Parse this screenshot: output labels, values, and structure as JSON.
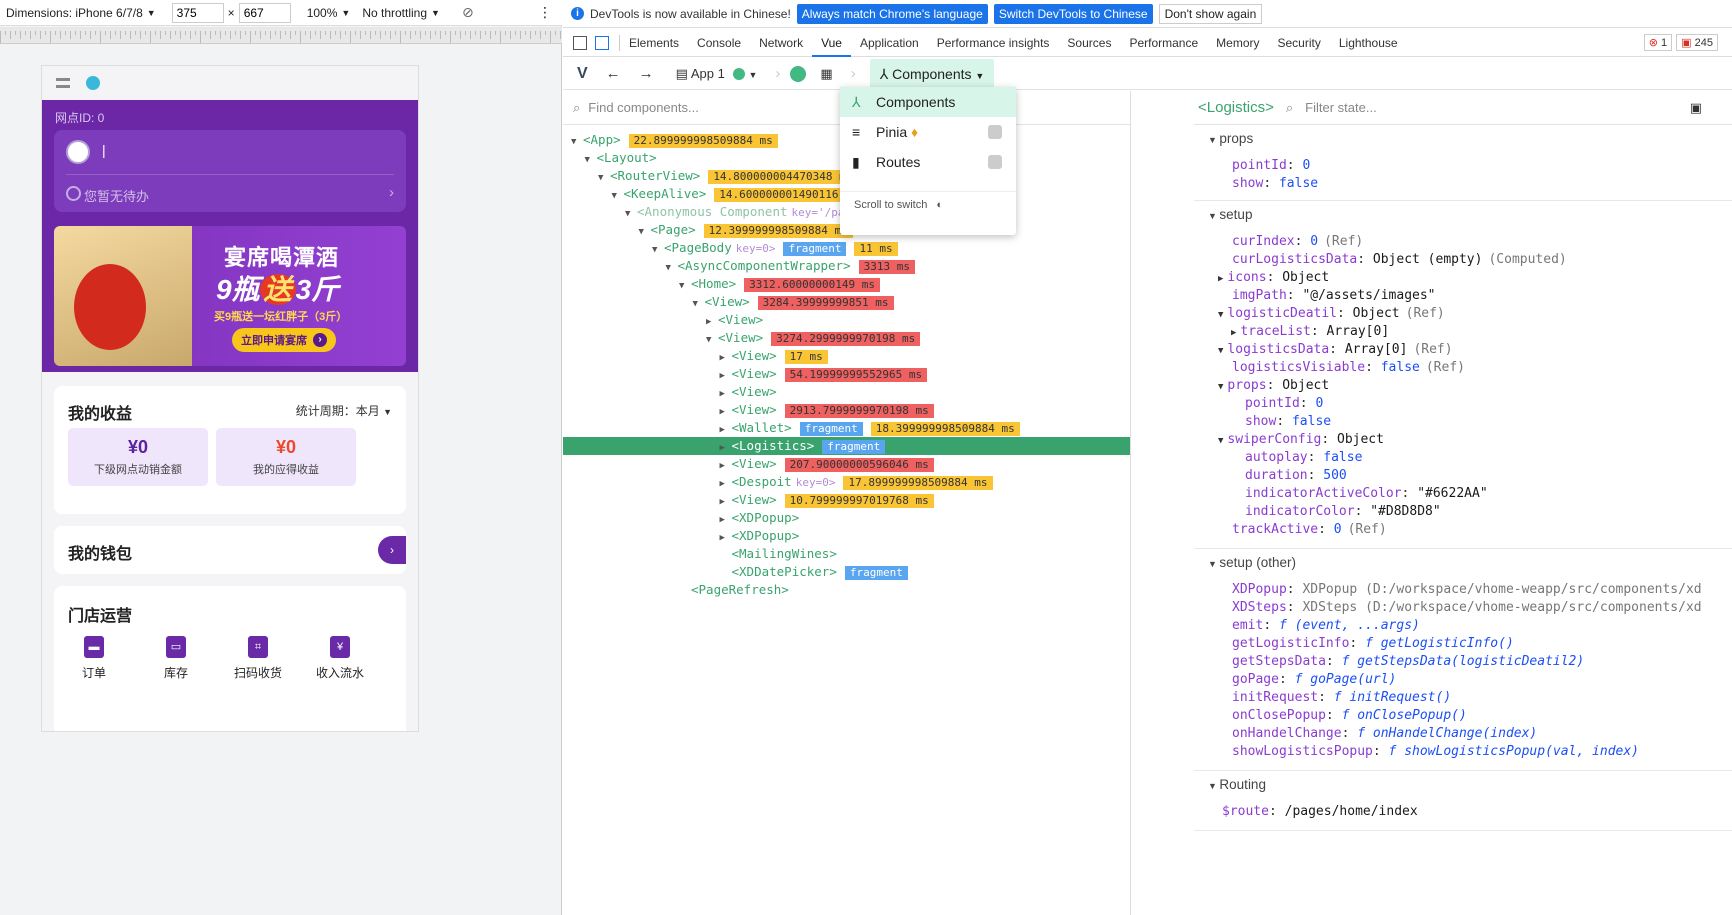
{
  "device": {
    "dimensions": "Dimensions: iPhone 6/7/8",
    "width": "375",
    "height": "667",
    "zoom": "100%",
    "throttling": "No throttling"
  },
  "phone": {
    "point_id": "网点ID: 0",
    "user_name": "|",
    "todo": "您暂无待办",
    "banner": {
      "line1": "宴席喝潭酒",
      "line2a": "9瓶",
      "line2b": "送",
      "line2c": "3斤",
      "line3": "买9瓶送一坛红胖子（3斤）",
      "button": "立即申请宴席"
    },
    "income": {
      "title": "我的收益",
      "period": "统计周期：本月",
      "box1_value": "¥0",
      "box1_label": "下级网点动销金额",
      "box2_value": "¥0",
      "box2_label": "我的应得收益"
    },
    "wallet_title": "我的钱包",
    "store": {
      "title": "门店运营",
      "items": [
        "订单",
        "库存",
        "扫码收货",
        "收入流水"
      ]
    }
  },
  "infobar": {
    "message": "DevTools is now available in Chinese!",
    "btn1": "Always match Chrome's language",
    "btn2": "Switch DevTools to Chinese",
    "btn3": "Don't show again"
  },
  "tabs": [
    "Elements",
    "Console",
    "Network",
    "Vue",
    "Application",
    "Performance insights",
    "Sources",
    "Performance",
    "Memory",
    "Security",
    "Lighthouse"
  ],
  "badges": {
    "errors": "1",
    "warnings": "245"
  },
  "vuebar": {
    "app": "App 1",
    "components": "Components"
  },
  "search_placeholder": "Find components...",
  "dropdown": {
    "items": [
      "Components",
      "Pinia",
      "Routes"
    ],
    "hint": "Scroll to switch"
  },
  "tree": [
    {
      "indent": 0,
      "arrow": "▼",
      "tag": "<App>",
      "ms": "22.899999998509884 ms",
      "mc": "y"
    },
    {
      "indent": 1,
      "arrow": "▼",
      "tag": "<Layout>"
    },
    {
      "indent": 2,
      "arrow": "▼",
      "tag": "<RouterView>",
      "ms": "14.800000004470348 ms",
      "mc": "y",
      "route": "/page"
    },
    {
      "indent": 3,
      "arrow": "▼",
      "tag": "<KeepAlive>",
      "ms": "14.600000001490116 ms",
      "mc": "y"
    },
    {
      "indent": 4,
      "arrow": "▼",
      "tag": "<Anonymous Component",
      "key": "key='/pages/home",
      "ms": "1490116 ms",
      "mc": "y",
      "gray": true
    },
    {
      "indent": 5,
      "arrow": "▼",
      "tag": "<Page>",
      "ms": "12.399999998509884 ms",
      "mc": "y"
    },
    {
      "indent": 6,
      "arrow": "▼",
      "tag": "<PageBody",
      "key": "key=0>",
      "frag": "fragment",
      "ms": "11 ms",
      "mc": "y"
    },
    {
      "indent": 7,
      "arrow": "▼",
      "tag": "<AsyncComponentWrapper>",
      "ms": "3313 ms",
      "mc": "r"
    },
    {
      "indent": 8,
      "arrow": "▼",
      "tag": "<Home>",
      "ms": "3312.60000000149 ms",
      "mc": "r"
    },
    {
      "indent": 9,
      "arrow": "▼",
      "tag": "<View>",
      "ms": "3284.39999999851 ms",
      "mc": "r"
    },
    {
      "indent": 10,
      "arrow": "▶",
      "tag": "<View>"
    },
    {
      "indent": 10,
      "arrow": "▼",
      "tag": "<View>",
      "ms": "3274.2999999970198 ms",
      "mc": "r"
    },
    {
      "indent": 11,
      "arrow": "▶",
      "tag": "<View>",
      "ms": "17 ms",
      "mc": "y"
    },
    {
      "indent": 11,
      "arrow": "▶",
      "tag": "<View>",
      "ms": "54.19999999552965 ms",
      "mc": "r"
    },
    {
      "indent": 11,
      "arrow": "▶",
      "tag": "<View>"
    },
    {
      "indent": 11,
      "arrow": "▶",
      "tag": "<View>",
      "ms": "2913.7999999970198 ms",
      "mc": "r"
    },
    {
      "indent": 11,
      "arrow": "▶",
      "tag": "<Wallet>",
      "frag": "fragment",
      "ms": "18.399999998509884 ms",
      "mc": "y"
    },
    {
      "indent": 11,
      "arrow": "▶",
      "tag": "<Logistics>",
      "frag": "fragment",
      "sel": true
    },
    {
      "indent": 11,
      "arrow": "▶",
      "tag": "<View>",
      "ms": "207.90000000596046 ms",
      "mc": "r"
    },
    {
      "indent": 11,
      "arrow": "▶",
      "tag": "<Despoit",
      "key": "key=0>",
      "ms": "17.899999998509884 ms",
      "mc": "y"
    },
    {
      "indent": 11,
      "arrow": "▶",
      "tag": "<View>",
      "ms": "10.799999997019768 ms",
      "mc": "y"
    },
    {
      "indent": 11,
      "arrow": "▶",
      "tag": "<XDPopup>"
    },
    {
      "indent": 11,
      "arrow": "▶",
      "tag": "<XDPopup>"
    },
    {
      "indent": 11,
      "arrow": "",
      "tag": "<MailingWines>"
    },
    {
      "indent": 11,
      "arrow": "",
      "tag": "<XDDatePicker>",
      "frag": "fragment"
    },
    {
      "indent": 8,
      "arrow": "",
      "tag": "<PageRefresh>"
    }
  ],
  "state": {
    "component": "<Logistics>",
    "filter_placeholder": "Filter state...",
    "sections": {
      "props": "props",
      "setup": "setup",
      "setup_other": "setup (other)",
      "routing": "Routing"
    },
    "props": [
      {
        "k": "pointId",
        "v": "0",
        "c": "vn"
      },
      {
        "k": "show",
        "v": "false",
        "c": "vn"
      }
    ],
    "setup": [
      {
        "ind": 0,
        "k": "curIndex",
        "v": "0",
        "c": "vn",
        "m": "(Ref)"
      },
      {
        "ind": 0,
        "k": "curLogisticsData",
        "v": "Object (empty)",
        "c": "v",
        "m": "(Computed)"
      },
      {
        "ind": 0,
        "a": "▶",
        "k": "icons",
        "v": "Object",
        "c": "v"
      },
      {
        "ind": 0,
        "k": "imgPath",
        "v": "\"@/assets/images\"",
        "c": "vs"
      },
      {
        "ind": 0,
        "a": "▼",
        "k": "logisticDeatil",
        "v": "Object",
        "c": "v",
        "m": "(Ref)"
      },
      {
        "ind": 1,
        "a": "▶",
        "k": "traceList",
        "v": "Array[0]",
        "c": "v"
      },
      {
        "ind": 0,
        "a": "▼",
        "k": "logisticsData",
        "v": "Array[0]",
        "c": "v",
        "m": "(Ref)"
      },
      {
        "ind": 0,
        "k": "logisticsVisiable",
        "v": "false",
        "c": "vn",
        "m": "(Ref)"
      },
      {
        "ind": 0,
        "a": "▼",
        "k": "props",
        "v": "Object",
        "c": "v"
      },
      {
        "ind": 1,
        "k": "pointId",
        "v": "0",
        "c": "vn"
      },
      {
        "ind": 1,
        "k": "show",
        "v": "false",
        "c": "vn"
      },
      {
        "ind": 0,
        "a": "▼",
        "k": "swiperConfig",
        "v": "Object",
        "c": "v"
      },
      {
        "ind": 1,
        "k": "autoplay",
        "v": "false",
        "c": "vn"
      },
      {
        "ind": 1,
        "k": "duration",
        "v": "500",
        "c": "vn"
      },
      {
        "ind": 1,
        "k": "indicatorActiveColor",
        "v": "\"#6622AA\"",
        "c": "vs"
      },
      {
        "ind": 1,
        "k": "indicatorColor",
        "v": "\"#D8D8D8\"",
        "c": "vs"
      },
      {
        "ind": 0,
        "k": "trackActive",
        "v": "0",
        "c": "vn",
        "m": "(Ref)"
      }
    ],
    "other": [
      {
        "k": "XDPopup",
        "v": "XDPopup (D:/workspace/vhome-weapp/src/components/xd",
        "c": "vm"
      },
      {
        "k": "XDSteps",
        "v": "XDSteps (D:/workspace/vhome-weapp/src/components/xd",
        "c": "vm"
      },
      {
        "k": "emit",
        "v": "f (event, ...args)",
        "c": "fn"
      },
      {
        "k": "getLogisticInfo",
        "v": "f getLogisticInfo()",
        "c": "fn"
      },
      {
        "k": "getStepsData",
        "v": "f getStepsData(logisticDeatil2)",
        "c": "fn"
      },
      {
        "k": "goPage",
        "v": "f goPage(url)",
        "c": "fn"
      },
      {
        "k": "initRequest",
        "v": "f initRequest()",
        "c": "fn"
      },
      {
        "k": "onClosePopup",
        "v": "f onClosePopup()",
        "c": "fn"
      },
      {
        "k": "onHandelChange",
        "v": "f onHandelChange(index)",
        "c": "fn"
      },
      {
        "k": "showLogisticsPopup",
        "v": "f showLogisticsPopup(val, index)",
        "c": "fn"
      }
    ],
    "routing": [
      {
        "k": "$route",
        "v": "/pages/home/index",
        "c": "v"
      }
    ]
  },
  "colors": {
    "vue_green": "#3aa36d",
    "purple": "#6a2aa8",
    "accent": "#1a73e8"
  }
}
